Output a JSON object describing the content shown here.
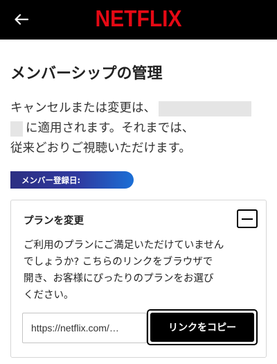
{
  "header": {
    "back_icon": "arrow-left-icon",
    "logo_text": "NETFLIX",
    "brand_color": "#e50914"
  },
  "page": {
    "title": "メンバーシップの管理"
  },
  "notice": {
    "line1": "キャンセルまたは変更は、",
    "line2": "に適用されます。それまでは、",
    "line3": "従来どおりご視聴いただけます。"
  },
  "member_badge": {
    "label": "メンバー登録日:"
  },
  "plan_card": {
    "title": "プランを変更",
    "collapse_icon": "minus-icon",
    "description_lines": [
      "ご利用のプランにご満足いただけていません",
      "でしょうか? こちらのリンクをブラウザで",
      "開き、お客様にぴったりのプランをお選び",
      "ください。"
    ],
    "link_value": "https://netflix.com/…",
    "copy_button_label": "リンクをコピー"
  }
}
